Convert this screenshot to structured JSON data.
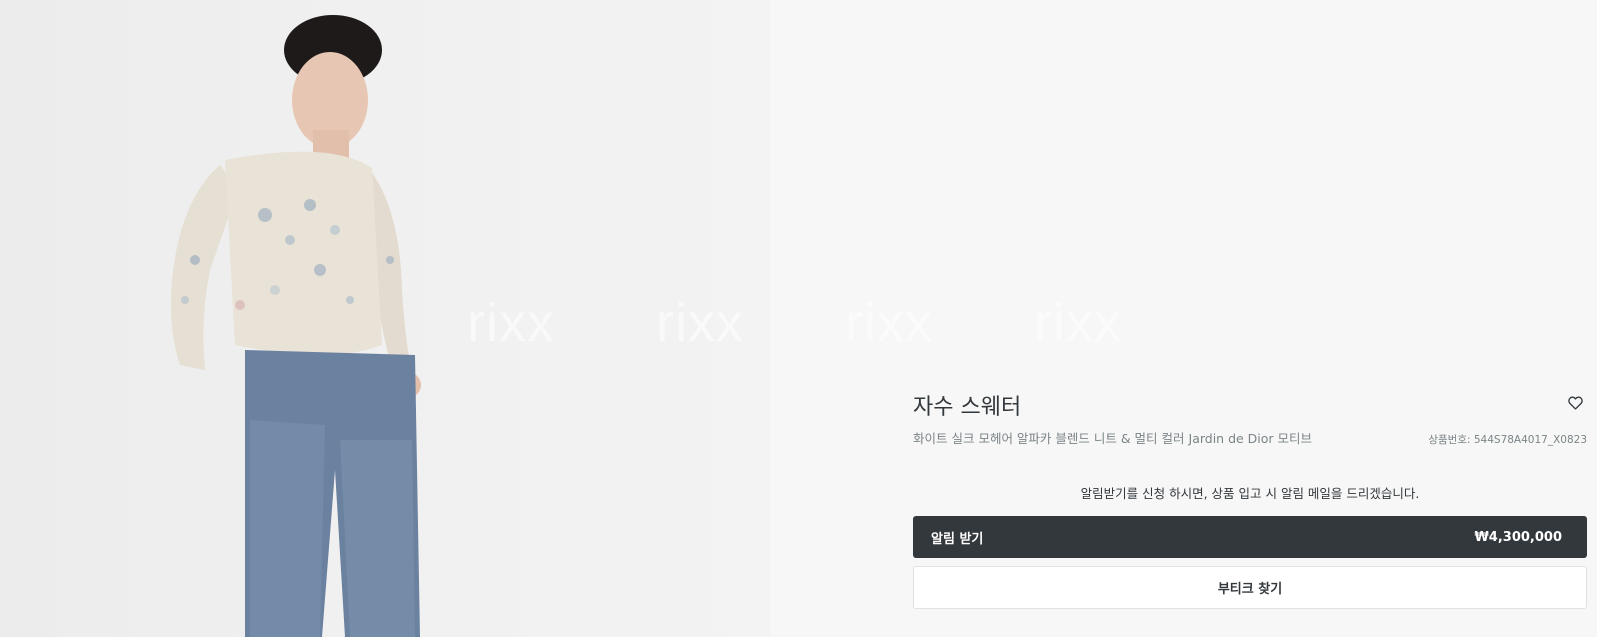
{
  "product": {
    "title": "자수 스웨터",
    "description": "화이트 실크 모헤어 알파카 블렌드 니트 & 멀티 컬러 Jardin de Dior 모티브",
    "sku": "상품번호: 544S78A4017_X0823",
    "image_icon": "model-photo"
  },
  "watermark": [
    "rixx",
    "rixx",
    "rixx",
    "rixx"
  ],
  "notify": {
    "note": "알림받기를 신청 하시면, 상품 입고 시 알림 메일을 드리겠습니다.",
    "button_label": "알림 받기",
    "price": "₩4,300,000"
  },
  "boutique": {
    "button_label": "부티크 찾기"
  },
  "wishlist": {
    "icon": "heart-icon"
  },
  "colors": {
    "primary_button": "#33383c",
    "page_bg": "#f7f7f7",
    "muted_text": "#7b8487"
  }
}
